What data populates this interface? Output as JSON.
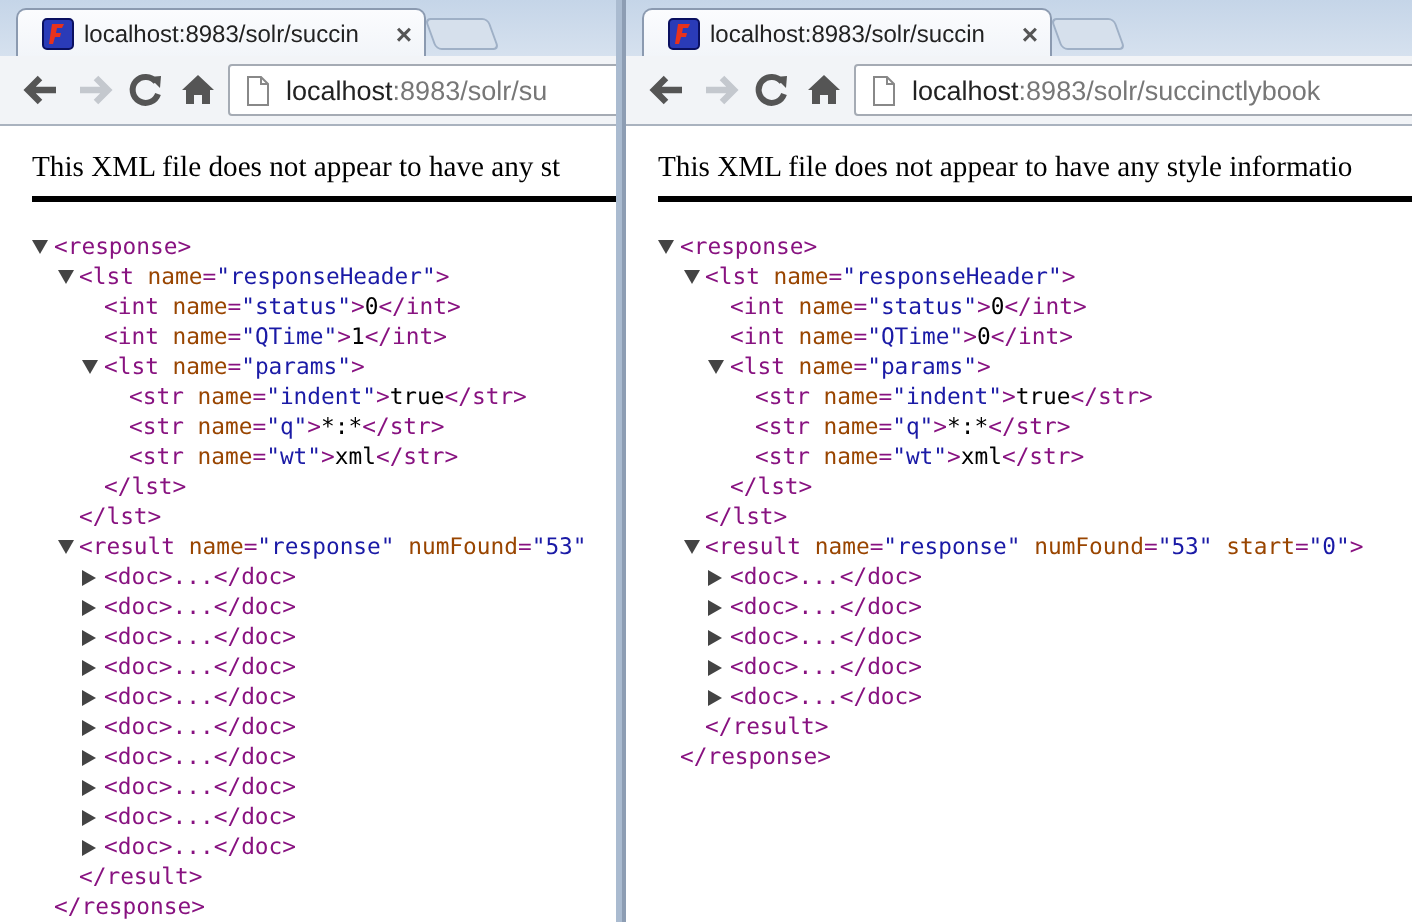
{
  "windows": [
    {
      "tab": {
        "title": "localhost:8983/solr/succin",
        "close": "×",
        "selected": true
      },
      "toolbar": {
        "buttons": [
          {
            "kind": "back",
            "disabled": false
          },
          {
            "kind": "forward",
            "disabled": true
          },
          {
            "kind": "reload",
            "disabled": false
          },
          {
            "kind": "home",
            "disabled": false
          }
        ],
        "url_host": "localhost",
        "url_rest": ":8983/solr/su"
      },
      "notice": "This XML file does not appear to have any st",
      "tree": {
        "expanded": true,
        "open": [
          {
            "kind": "tag",
            "text": "<response>"
          }
        ],
        "close": [
          {
            "kind": "tag",
            "text": "</response>"
          }
        ],
        "children": [
          {
            "expanded": true,
            "open": [
              {
                "kind": "tag",
                "text": "<lst"
              },
              {
                "kind": "attr",
                "text": " name"
              },
              {
                "kind": "tag",
                "text": "="
              },
              {
                "kind": "val",
                "text": "\"responseHeader\""
              },
              {
                "kind": "tag",
                "text": ">"
              }
            ],
            "close": [
              {
                "kind": "tag",
                "text": "</lst>"
              }
            ],
            "children": [
              {
                "open": [
                  {
                    "kind": "tag",
                    "text": "<int"
                  },
                  {
                    "kind": "attr",
                    "text": " name"
                  },
                  {
                    "kind": "tag",
                    "text": "="
                  },
                  {
                    "kind": "val",
                    "text": "\"status\""
                  },
                  {
                    "kind": "tag",
                    "text": ">"
                  },
                  {
                    "kind": "plain",
                    "text": "0"
                  },
                  {
                    "kind": "tag",
                    "text": "</int>"
                  }
                ]
              },
              {
                "open": [
                  {
                    "kind": "tag",
                    "text": "<int"
                  },
                  {
                    "kind": "attr",
                    "text": " name"
                  },
                  {
                    "kind": "tag",
                    "text": "="
                  },
                  {
                    "kind": "val",
                    "text": "\"QTime\""
                  },
                  {
                    "kind": "tag",
                    "text": ">"
                  },
                  {
                    "kind": "plain",
                    "text": "1"
                  },
                  {
                    "kind": "tag",
                    "text": "</int>"
                  }
                ]
              },
              {
                "expanded": true,
                "open": [
                  {
                    "kind": "tag",
                    "text": "<lst"
                  },
                  {
                    "kind": "attr",
                    "text": " name"
                  },
                  {
                    "kind": "tag",
                    "text": "="
                  },
                  {
                    "kind": "val",
                    "text": "\"params\""
                  },
                  {
                    "kind": "tag",
                    "text": ">"
                  }
                ],
                "close": [
                  {
                    "kind": "tag",
                    "text": "</lst>"
                  }
                ],
                "children": [
                  {
                    "open": [
                      {
                        "kind": "tag",
                        "text": "<str"
                      },
                      {
                        "kind": "attr",
                        "text": " name"
                      },
                      {
                        "kind": "tag",
                        "text": "="
                      },
                      {
                        "kind": "val",
                        "text": "\"indent\""
                      },
                      {
                        "kind": "tag",
                        "text": ">"
                      },
                      {
                        "kind": "plain",
                        "text": "true"
                      },
                      {
                        "kind": "tag",
                        "text": "</str>"
                      }
                    ]
                  },
                  {
                    "open": [
                      {
                        "kind": "tag",
                        "text": "<str"
                      },
                      {
                        "kind": "attr",
                        "text": " name"
                      },
                      {
                        "kind": "tag",
                        "text": "="
                      },
                      {
                        "kind": "val",
                        "text": "\"q\""
                      },
                      {
                        "kind": "tag",
                        "text": ">"
                      },
                      {
                        "kind": "plain",
                        "text": "*:*"
                      },
                      {
                        "kind": "tag",
                        "text": "</str>"
                      }
                    ]
                  },
                  {
                    "open": [
                      {
                        "kind": "tag",
                        "text": "<str"
                      },
                      {
                        "kind": "attr",
                        "text": " name"
                      },
                      {
                        "kind": "tag",
                        "text": "="
                      },
                      {
                        "kind": "val",
                        "text": "\"wt\""
                      },
                      {
                        "kind": "tag",
                        "text": ">"
                      },
                      {
                        "kind": "plain",
                        "text": "xml"
                      },
                      {
                        "kind": "tag",
                        "text": "</str>"
                      }
                    ]
                  }
                ]
              }
            ]
          },
          {
            "expanded": true,
            "open": [
              {
                "kind": "tag",
                "text": "<result"
              },
              {
                "kind": "attr",
                "text": " name"
              },
              {
                "kind": "tag",
                "text": "="
              },
              {
                "kind": "val",
                "text": "\"response\""
              },
              {
                "kind": "attr",
                "text": " numFound"
              },
              {
                "kind": "tag",
                "text": "="
              },
              {
                "kind": "val",
                "text": "\"53\""
              }
            ],
            "close": [
              {
                "kind": "tag",
                "text": "</result>"
              }
            ],
            "children": [
              {
                "expanded": false,
                "open": [
                  {
                    "kind": "tag",
                    "text": "<doc>...</doc>"
                  }
                ]
              },
              {
                "expanded": false,
                "open": [
                  {
                    "kind": "tag",
                    "text": "<doc>...</doc>"
                  }
                ]
              },
              {
                "expanded": false,
                "open": [
                  {
                    "kind": "tag",
                    "text": "<doc>...</doc>"
                  }
                ]
              },
              {
                "expanded": false,
                "open": [
                  {
                    "kind": "tag",
                    "text": "<doc>...</doc>"
                  }
                ]
              },
              {
                "expanded": false,
                "open": [
                  {
                    "kind": "tag",
                    "text": "<doc>...</doc>"
                  }
                ]
              },
              {
                "expanded": false,
                "open": [
                  {
                    "kind": "tag",
                    "text": "<doc>...</doc>"
                  }
                ]
              },
              {
                "expanded": false,
                "open": [
                  {
                    "kind": "tag",
                    "text": "<doc>...</doc>"
                  }
                ]
              },
              {
                "expanded": false,
                "open": [
                  {
                    "kind": "tag",
                    "text": "<doc>...</doc>"
                  }
                ]
              },
              {
                "expanded": false,
                "open": [
                  {
                    "kind": "tag",
                    "text": "<doc>...</doc>"
                  }
                ]
              },
              {
                "expanded": false,
                "open": [
                  {
                    "kind": "tag",
                    "text": "<doc>...</doc>"
                  }
                ]
              }
            ]
          }
        ]
      }
    },
    {
      "tab": {
        "title": "localhost:8983/solr/succin",
        "close": "×",
        "selected": true
      },
      "toolbar": {
        "buttons": [
          {
            "kind": "back",
            "disabled": false
          },
          {
            "kind": "forward",
            "disabled": true
          },
          {
            "kind": "reload",
            "disabled": false
          },
          {
            "kind": "home",
            "disabled": false
          }
        ],
        "url_host": "localhost",
        "url_rest": ":8983/solr/succinctlybook"
      },
      "notice": "This XML file does not appear to have any style informatio",
      "tree": {
        "expanded": true,
        "open": [
          {
            "kind": "tag",
            "text": "<response>"
          }
        ],
        "close": [
          {
            "kind": "tag",
            "text": "</response>"
          }
        ],
        "children": [
          {
            "expanded": true,
            "open": [
              {
                "kind": "tag",
                "text": "<lst"
              },
              {
                "kind": "attr",
                "text": " name"
              },
              {
                "kind": "tag",
                "text": "="
              },
              {
                "kind": "val",
                "text": "\"responseHeader\""
              },
              {
                "kind": "tag",
                "text": ">"
              }
            ],
            "close": [
              {
                "kind": "tag",
                "text": "</lst>"
              }
            ],
            "children": [
              {
                "open": [
                  {
                    "kind": "tag",
                    "text": "<int"
                  },
                  {
                    "kind": "attr",
                    "text": " name"
                  },
                  {
                    "kind": "tag",
                    "text": "="
                  },
                  {
                    "kind": "val",
                    "text": "\"status\""
                  },
                  {
                    "kind": "tag",
                    "text": ">"
                  },
                  {
                    "kind": "plain",
                    "text": "0"
                  },
                  {
                    "kind": "tag",
                    "text": "</int>"
                  }
                ]
              },
              {
                "open": [
                  {
                    "kind": "tag",
                    "text": "<int"
                  },
                  {
                    "kind": "attr",
                    "text": " name"
                  },
                  {
                    "kind": "tag",
                    "text": "="
                  },
                  {
                    "kind": "val",
                    "text": "\"QTime\""
                  },
                  {
                    "kind": "tag",
                    "text": ">"
                  },
                  {
                    "kind": "plain",
                    "text": "0"
                  },
                  {
                    "kind": "tag",
                    "text": "</int>"
                  }
                ]
              },
              {
                "expanded": true,
                "open": [
                  {
                    "kind": "tag",
                    "text": "<lst"
                  },
                  {
                    "kind": "attr",
                    "text": " name"
                  },
                  {
                    "kind": "tag",
                    "text": "="
                  },
                  {
                    "kind": "val",
                    "text": "\"params\""
                  },
                  {
                    "kind": "tag",
                    "text": ">"
                  }
                ],
                "close": [
                  {
                    "kind": "tag",
                    "text": "</lst>"
                  }
                ],
                "children": [
                  {
                    "open": [
                      {
                        "kind": "tag",
                        "text": "<str"
                      },
                      {
                        "kind": "attr",
                        "text": " name"
                      },
                      {
                        "kind": "tag",
                        "text": "="
                      },
                      {
                        "kind": "val",
                        "text": "\"indent\""
                      },
                      {
                        "kind": "tag",
                        "text": ">"
                      },
                      {
                        "kind": "plain",
                        "text": "true"
                      },
                      {
                        "kind": "tag",
                        "text": "</str>"
                      }
                    ]
                  },
                  {
                    "open": [
                      {
                        "kind": "tag",
                        "text": "<str"
                      },
                      {
                        "kind": "attr",
                        "text": " name"
                      },
                      {
                        "kind": "tag",
                        "text": "="
                      },
                      {
                        "kind": "val",
                        "text": "\"q\""
                      },
                      {
                        "kind": "tag",
                        "text": ">"
                      },
                      {
                        "kind": "plain",
                        "text": "*:*"
                      },
                      {
                        "kind": "tag",
                        "text": "</str>"
                      }
                    ]
                  },
                  {
                    "open": [
                      {
                        "kind": "tag",
                        "text": "<str"
                      },
                      {
                        "kind": "attr",
                        "text": " name"
                      },
                      {
                        "kind": "tag",
                        "text": "="
                      },
                      {
                        "kind": "val",
                        "text": "\"wt\""
                      },
                      {
                        "kind": "tag",
                        "text": ">"
                      },
                      {
                        "kind": "plain",
                        "text": "xml"
                      },
                      {
                        "kind": "tag",
                        "text": "</str>"
                      }
                    ]
                  }
                ]
              }
            ]
          },
          {
            "expanded": true,
            "open": [
              {
                "kind": "tag",
                "text": "<result"
              },
              {
                "kind": "attr",
                "text": " name"
              },
              {
                "kind": "tag",
                "text": "="
              },
              {
                "kind": "val",
                "text": "\"response\""
              },
              {
                "kind": "attr",
                "text": " numFound"
              },
              {
                "kind": "tag",
                "text": "="
              },
              {
                "kind": "val",
                "text": "\"53\""
              },
              {
                "kind": "attr",
                "text": " start"
              },
              {
                "kind": "tag",
                "text": "="
              },
              {
                "kind": "val",
                "text": "\"0\""
              },
              {
                "kind": "tag",
                "text": ">"
              }
            ],
            "close": [
              {
                "kind": "tag",
                "text": "</result>"
              }
            ],
            "children": [
              {
                "expanded": false,
                "open": [
                  {
                    "kind": "tag",
                    "text": "<doc>...</doc>"
                  }
                ]
              },
              {
                "expanded": false,
                "open": [
                  {
                    "kind": "tag",
                    "text": "<doc>...</doc>"
                  }
                ]
              },
              {
                "expanded": false,
                "open": [
                  {
                    "kind": "tag",
                    "text": "<doc>...</doc>"
                  }
                ]
              },
              {
                "expanded": false,
                "open": [
                  {
                    "kind": "tag",
                    "text": "<doc>...</doc>"
                  }
                ]
              },
              {
                "expanded": false,
                "open": [
                  {
                    "kind": "tag",
                    "text": "<doc>...</doc>"
                  }
                ]
              }
            ]
          }
        ]
      }
    }
  ]
}
